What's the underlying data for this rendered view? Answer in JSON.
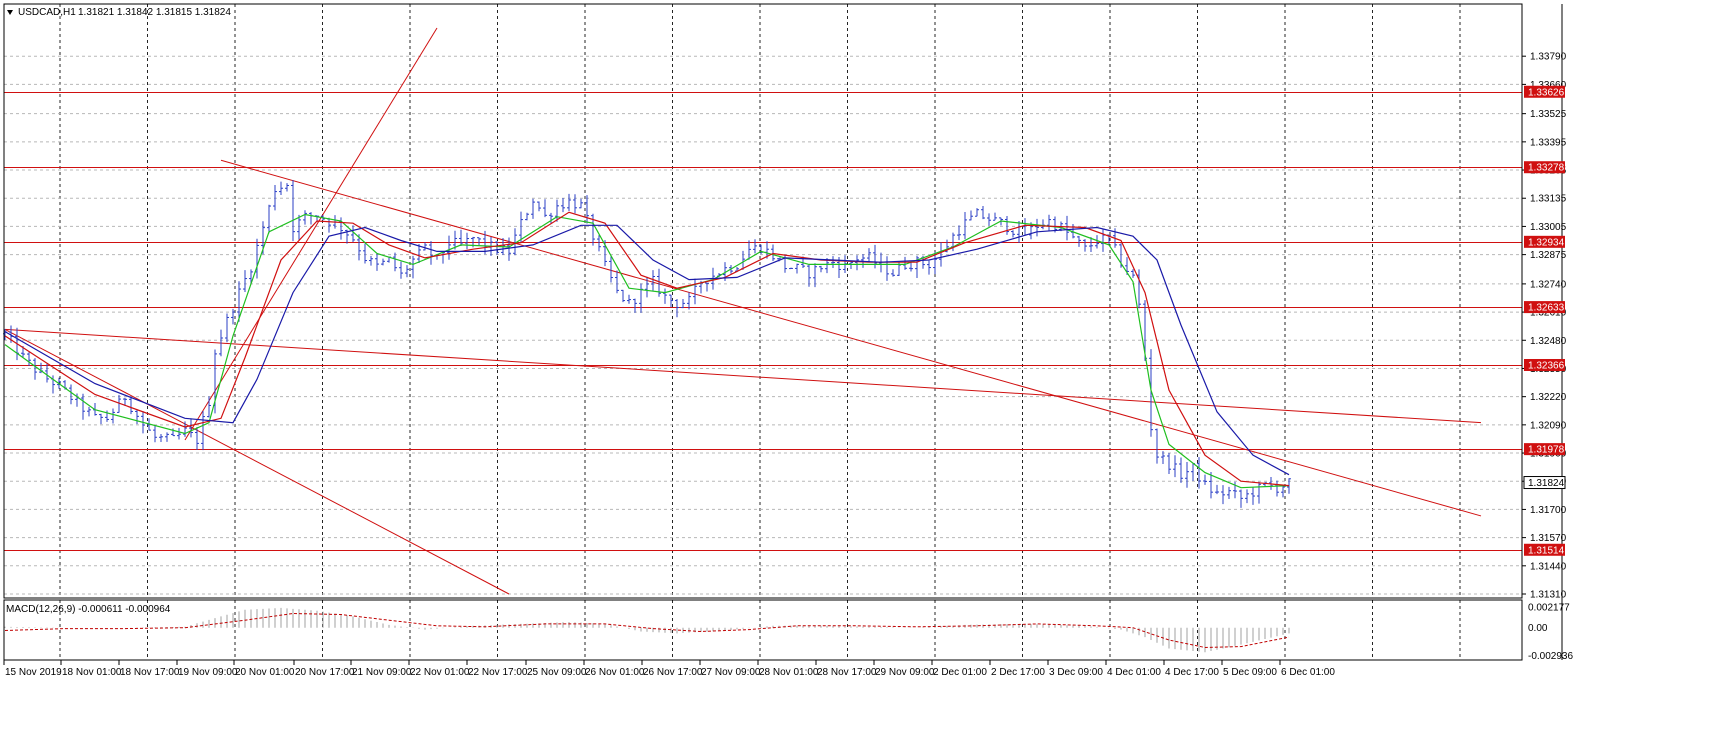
{
  "header": {
    "symbol": "USDCAD,H1",
    "ohlc": "1.31821 1.31842 1.31815 1.31824",
    "menu_icon": "triangle-down-icon"
  },
  "macd_header": {
    "label": "MACD(12,26,9) -0.000611 -0.000964"
  },
  "colors": {
    "candle": "#2b3fc6",
    "ma_fast": "#1fbf1f",
    "ma_mid": "#d01010",
    "ma_slow": "#1a1aa8",
    "level": "#d01010",
    "grid": "#000000",
    "macd_hist": "#a0a0a0",
    "macd_signal": "#c00000"
  },
  "chart_data": [
    {
      "type": "line",
      "title": "USDCAD,H1",
      "ylim": [
        1.3131,
        1.3392
      ],
      "y_ticks": [
        "1.33790",
        "1.33660",
        "1.33525",
        "1.33395",
        "1.33265",
        "1.33135",
        "1.33005",
        "1.32875",
        "1.32740",
        "1.32610",
        "1.32480",
        "1.32350",
        "1.32220",
        "1.32090",
        "1.31960",
        "1.31830",
        "1.31700",
        "1.31570",
        "1.31440",
        "1.31310"
      ],
      "x_ticks": [
        "15 Nov 2019",
        "18 Nov 01:00",
        "18 Nov 17:00",
        "19 Nov 09:00",
        "20 Nov 01:00",
        "20 Nov 17:00",
        "21 Nov 09:00",
        "22 Nov 01:00",
        "22 Nov 17:00",
        "25 Nov 09:00",
        "26 Nov 01:00",
        "26 Nov 17:00",
        "27 Nov 09:00",
        "28 Nov 01:00",
        "28 Nov 17:00",
        "29 Nov 09:00",
        "2 Dec 01:00",
        "2 Dec 17:00",
        "3 Dec 09:00",
        "4 Dec 01:00",
        "4 Dec 17:00",
        "5 Dec 09:00",
        "6 Dec 01:00"
      ],
      "current_price": "1.31824",
      "horizontal_levels": [
        "1.33626",
        "1.33278",
        "1.32934",
        "1.32633",
        "1.32366",
        "1.31978",
        "1.31514"
      ],
      "close_path": [
        [
          0,
          1.3251
        ],
        [
          3,
          1.324
        ],
        [
          6,
          1.3232
        ],
        [
          9,
          1.3227
        ],
        [
          12,
          1.3219
        ],
        [
          15,
          1.3212
        ],
        [
          17,
          1.3212
        ],
        [
          20,
          1.3222
        ],
        [
          23,
          1.3209
        ],
        [
          25,
          1.3203
        ],
        [
          28,
          1.3202
        ],
        [
          30,
          1.3206
        ],
        [
          32,
          1.3202
        ],
        [
          34,
          1.322
        ],
        [
          35,
          1.3243
        ],
        [
          37,
          1.3257
        ],
        [
          39,
          1.327
        ],
        [
          41,
          1.3282
        ],
        [
          43,
          1.33
        ],
        [
          45,
          1.3318
        ],
        [
          47,
          1.332
        ],
        [
          48,
          1.33
        ],
        [
          50,
          1.3305
        ],
        [
          52,
          1.3306
        ],
        [
          54,
          1.3303
        ],
        [
          56,
          1.33
        ],
        [
          58,
          1.3295
        ],
        [
          60,
          1.3286
        ],
        [
          62,
          1.3282
        ],
        [
          64,
          1.3285
        ],
        [
          66,
          1.3278
        ],
        [
          68,
          1.3285
        ],
        [
          70,
          1.329
        ],
        [
          72,
          1.3285
        ],
        [
          74,
          1.3293
        ],
        [
          76,
          1.3292
        ],
        [
          78,
          1.3295
        ],
        [
          80,
          1.3292
        ],
        [
          82,
          1.329
        ],
        [
          84,
          1.3289
        ],
        [
          86,
          1.3302
        ],
        [
          88,
          1.3313
        ],
        [
          90,
          1.3305
        ],
        [
          92,
          1.331
        ],
        [
          94,
          1.3312
        ],
        [
          96,
          1.331
        ],
        [
          98,
          1.3296
        ],
        [
          100,
          1.3282
        ],
        [
          102,
          1.327
        ],
        [
          104,
          1.3265
        ],
        [
          106,
          1.327
        ],
        [
          108,
          1.3275
        ],
        [
          110,
          1.3268
        ],
        [
          112,
          1.3265
        ],
        [
          114,
          1.3266
        ],
        [
          116,
          1.3275
        ],
        [
          118,
          1.3278
        ],
        [
          120,
          1.3281
        ],
        [
          122,
          1.3283
        ],
        [
          124,
          1.329
        ],
        [
          126,
          1.3291
        ],
        [
          128,
          1.3287
        ],
        [
          130,
          1.3282
        ],
        [
          132,
          1.3281
        ],
        [
          134,
          1.3279
        ],
        [
          136,
          1.3282
        ],
        [
          138,
          1.3284
        ],
        [
          140,
          1.3282
        ],
        [
          142,
          1.3286
        ],
        [
          144,
          1.3286
        ],
        [
          146,
          1.3282
        ],
        [
          148,
          1.3279
        ],
        [
          150,
          1.3283
        ],
        [
          152,
          1.3284
        ],
        [
          154,
          1.3283
        ],
        [
          156,
          1.3288
        ],
        [
          158,
          1.3296
        ],
        [
          160,
          1.3302
        ],
        [
          162,
          1.3306
        ],
        [
          164,
          1.3304
        ],
        [
          166,
          1.3302
        ],
        [
          168,
          1.3299
        ],
        [
          170,
          1.3297
        ],
        [
          172,
          1.3301
        ],
        [
          174,
          1.3303
        ],
        [
          176,
          1.33
        ],
        [
          178,
          1.3295
        ],
        [
          180,
          1.329
        ],
        [
          182,
          1.3294
        ],
        [
          184,
          1.3295
        ],
        [
          186,
          1.3284
        ],
        [
          188,
          1.3277
        ],
        [
          189,
          1.3264
        ],
        [
          190,
          1.324
        ],
        [
          191,
          1.3208
        ],
        [
          192,
          1.3195
        ],
        [
          194,
          1.3191
        ],
        [
          196,
          1.3186
        ],
        [
          198,
          1.3189
        ],
        [
          200,
          1.3181
        ],
        [
          202,
          1.3177
        ],
        [
          204,
          1.3178
        ],
        [
          206,
          1.3175
        ],
        [
          208,
          1.3178
        ],
        [
          210,
          1.3181
        ],
        [
          212,
          1.318
        ],
        [
          214,
          1.3182
        ]
      ],
      "series": [
        {
          "name": "",
          "role": "ma_fast",
          "values": [
            [
              0,
              1.3246
            ],
            [
              15,
              1.3216
            ],
            [
              30,
              1.3205
            ],
            [
              34,
              1.321
            ],
            [
              38,
              1.325
            ],
            [
              44,
              1.3298
            ],
            [
              50,
              1.3306
            ],
            [
              56,
              1.3303
            ],
            [
              62,
              1.3288
            ],
            [
              68,
              1.3283
            ],
            [
              76,
              1.3292
            ],
            [
              84,
              1.3291
            ],
            [
              92,
              1.3305
            ],
            [
              98,
              1.3302
            ],
            [
              104,
              1.3272
            ],
            [
              110,
              1.327
            ],
            [
              118,
              1.3276
            ],
            [
              126,
              1.3289
            ],
            [
              134,
              1.3283
            ],
            [
              142,
              1.3283
            ],
            [
              150,
              1.3283
            ],
            [
              158,
              1.3291
            ],
            [
              166,
              1.3303
            ],
            [
              176,
              1.33
            ],
            [
              184,
              1.3292
            ],
            [
              188,
              1.3275
            ],
            [
              191,
              1.3225
            ],
            [
              194,
              1.32
            ],
            [
              200,
              1.3187
            ],
            [
              206,
              1.318
            ],
            [
              214,
              1.3181
            ]
          ]
        },
        {
          "name": "",
          "role": "ma_mid",
          "values": [
            [
              0,
              1.325
            ],
            [
              15,
              1.3223
            ],
            [
              30,
              1.3208
            ],
            [
              36,
              1.3212
            ],
            [
              40,
              1.324
            ],
            [
              46,
              1.3285
            ],
            [
              52,
              1.3303
            ],
            [
              58,
              1.3302
            ],
            [
              64,
              1.3292
            ],
            [
              70,
              1.3286
            ],
            [
              78,
              1.329
            ],
            [
              86,
              1.3293
            ],
            [
              94,
              1.3307
            ],
            [
              100,
              1.3302
            ],
            [
              106,
              1.3278
            ],
            [
              112,
              1.3272
            ],
            [
              120,
              1.3277
            ],
            [
              128,
              1.3288
            ],
            [
              136,
              1.3285
            ],
            [
              144,
              1.3284
            ],
            [
              152,
              1.3284
            ],
            [
              160,
              1.3293
            ],
            [
              170,
              1.3301
            ],
            [
              180,
              1.33
            ],
            [
              186,
              1.3294
            ],
            [
              190,
              1.327
            ],
            [
              194,
              1.3225
            ],
            [
              200,
              1.3195
            ],
            [
              206,
              1.3183
            ],
            [
              214,
              1.3181
            ]
          ]
        },
        {
          "name": "",
          "role": "ma_slow",
          "values": [
            [
              0,
              1.3252
            ],
            [
              15,
              1.3228
            ],
            [
              30,
              1.3212
            ],
            [
              38,
              1.321
            ],
            [
              42,
              1.323
            ],
            [
              48,
              1.327
            ],
            [
              54,
              1.3296
            ],
            [
              60,
              1.33
            ],
            [
              66,
              1.3294
            ],
            [
              72,
              1.3289
            ],
            [
              80,
              1.3289
            ],
            [
              88,
              1.3292
            ],
            [
              96,
              1.3301
            ],
            [
              102,
              1.3301
            ],
            [
              108,
              1.3285
            ],
            [
              114,
              1.3276
            ],
            [
              122,
              1.3277
            ],
            [
              130,
              1.3286
            ],
            [
              138,
              1.3285
            ],
            [
              146,
              1.3284
            ],
            [
              154,
              1.3285
            ],
            [
              162,
              1.329
            ],
            [
              172,
              1.3298
            ],
            [
              182,
              1.33
            ],
            [
              188,
              1.3296
            ],
            [
              192,
              1.3285
            ],
            [
              196,
              1.3255
            ],
            [
              202,
              1.3215
            ],
            [
              208,
              1.3195
            ],
            [
              214,
              1.3186
            ]
          ]
        }
      ],
      "trend_lines": [
        {
          "from": [
            0,
            1.3253
          ],
          "to": [
            246,
            1.321
          ]
        },
        {
          "from": [
            36,
            1.3331
          ],
          "to": [
            246,
            1.3167
          ]
        },
        {
          "from": [
            0,
            1.3253
          ],
          "to": [
            84,
            1.3131
          ]
        },
        {
          "from": [
            30,
            1.3202
          ],
          "to": [
            72,
            1.3392
          ]
        }
      ]
    },
    {
      "type": "bar",
      "title": "MACD(12,26,9) -0.000611 -0.000964",
      "ylim": [
        -0.003,
        0.0023
      ],
      "y_ticks": [
        "0.002177",
        "0.00",
        "-0.002936"
      ],
      "values": [
        [
          0,
          0.0001
        ],
        [
          10,
          0.0
        ],
        [
          20,
          0.0
        ],
        [
          30,
          0.0001
        ],
        [
          36,
          0.0012
        ],
        [
          40,
          0.0019
        ],
        [
          46,
          0.0021
        ],
        [
          52,
          0.0018
        ],
        [
          58,
          0.0012
        ],
        [
          64,
          0.0003
        ],
        [
          70,
          -0.0002
        ],
        [
          78,
          0.0002
        ],
        [
          86,
          0.0004
        ],
        [
          94,
          0.0006
        ],
        [
          100,
          0.0004
        ],
        [
          106,
          -0.0004
        ],
        [
          112,
          -0.0006
        ],
        [
          120,
          -0.0003
        ],
        [
          128,
          0.0002
        ],
        [
          136,
          0.0002
        ],
        [
          144,
          0.0001
        ],
        [
          152,
          0.0
        ],
        [
          160,
          0.0003
        ],
        [
          170,
          0.0004
        ],
        [
          180,
          0.0002
        ],
        [
          186,
          -0.0002
        ],
        [
          190,
          -0.001
        ],
        [
          194,
          -0.0022
        ],
        [
          200,
          -0.0026
        ],
        [
          206,
          -0.0018
        ],
        [
          214,
          -0.0006
        ]
      ],
      "signal": [
        [
          0,
          -0.0003
        ],
        [
          10,
          -0.0001
        ],
        [
          20,
          -0.0001
        ],
        [
          30,
          0.0
        ],
        [
          40,
          0.0008
        ],
        [
          48,
          0.0015
        ],
        [
          56,
          0.0014
        ],
        [
          64,
          0.0008
        ],
        [
          72,
          0.0002
        ],
        [
          80,
          0.0001
        ],
        [
          90,
          0.0004
        ],
        [
          100,
          0.0004
        ],
        [
          108,
          -0.0001
        ],
        [
          116,
          -0.0004
        ],
        [
          124,
          -0.0002
        ],
        [
          132,
          0.0002
        ],
        [
          142,
          0.0002
        ],
        [
          152,
          0.0001
        ],
        [
          162,
          0.0002
        ],
        [
          172,
          0.0004
        ],
        [
          182,
          0.0002
        ],
        [
          188,
          0.0
        ],
        [
          194,
          -0.0013
        ],
        [
          200,
          -0.0021
        ],
        [
          206,
          -0.002
        ],
        [
          214,
          -0.001
        ]
      ]
    }
  ]
}
